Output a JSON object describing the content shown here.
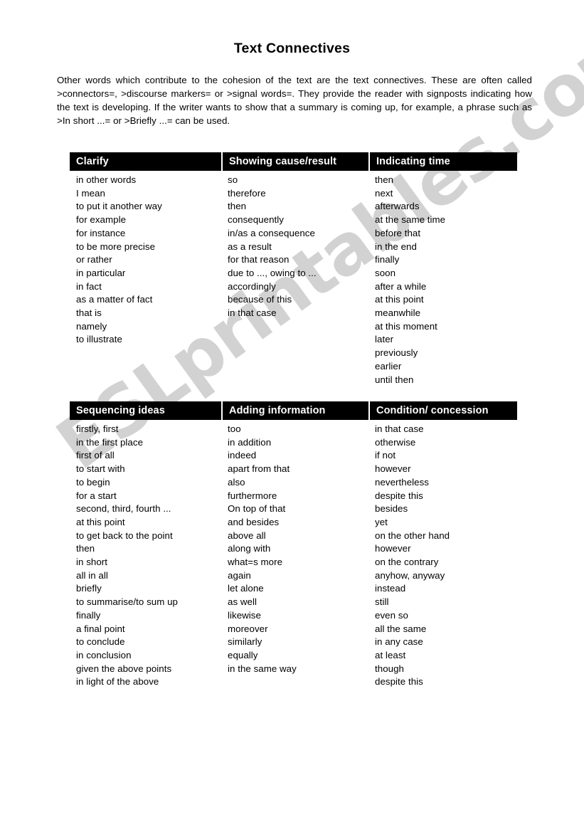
{
  "document": {
    "title": "Text Connectives",
    "intro": "Other words which contribute to the cohesion of the text are the text connectives. These are often called >connectors=, >discourse markers= or >signal words=. They provide the reader with signposts indicating how the text is developing. If the writer wants to show that a summary is coming up, for example, a phrase such as >In short ...= or >Briefly ...= can be used.",
    "watermark": "ESLprintables.com",
    "colors": {
      "header_background": "#000000",
      "header_text": "#ffffff",
      "body_text": "#000000",
      "page_background": "#ffffff",
      "watermark": "#d2d2d2"
    }
  },
  "tables": [
    {
      "id": "table-1",
      "columns": [
        {
          "header": "Clarify",
          "items": [
            "in other words",
            "I mean",
            "to put it another way",
            "for example",
            "for instance",
            "to be more precise",
            "or rather",
            "in particular",
            "in fact",
            "as a matter of fact",
            "that is",
            "namely",
            "to illustrate"
          ]
        },
        {
          "header": "Showing cause/result",
          "items": [
            "so",
            "therefore",
            "then",
            "consequently",
            "in/as a consequence",
            "as a result",
            "for that reason",
            "due to ..., owing to ...",
            "accordingly",
            "because of this",
            "in that case"
          ]
        },
        {
          "header": "Indicating time",
          "items": [
            "then",
            "next",
            "afterwards",
            "at the same time",
            "before that",
            "in the end",
            "finally",
            "soon",
            "after a while",
            "at this point",
            "meanwhile",
            "at this moment",
            "later",
            "previously",
            "earlier",
            "until then"
          ]
        }
      ]
    },
    {
      "id": "table-2",
      "columns": [
        {
          "header": "Sequencing ideas",
          "items": [
            "firstly, first",
            "in the first place",
            "first of all",
            "to start with",
            "to begin",
            "for a start",
            "second, third, fourth ...",
            "at this point",
            "to get back to the point",
            "then",
            "in short",
            "all in all",
            "briefly",
            "to summarise/to sum up",
            "finally",
            "a final point",
            "to conclude",
            "in conclusion",
            "given the above points",
            "in light of the above"
          ]
        },
        {
          "header": "Adding information",
          "items": [
            "too",
            "in addition",
            "indeed",
            "apart from that",
            "also",
            "furthermore",
            "On top of that",
            "and besides",
            "above all",
            "along with",
            "what=s more",
            "again",
            "let alone",
            "as well",
            "likewise",
            "moreover",
            "similarly",
            "equally",
            "in the same way"
          ]
        },
        {
          "header": "Condition/ concession",
          "items": [
            "in that case",
            "otherwise",
            "if not",
            "however",
            "nevertheless",
            "despite this",
            "besides",
            "yet",
            "on the other hand",
            "however",
            "on the contrary",
            "anyhow, anyway",
            "instead",
            "still",
            "even so",
            "all the same",
            "in any case",
            "at least",
            "though",
            "despite this"
          ]
        }
      ]
    }
  ]
}
